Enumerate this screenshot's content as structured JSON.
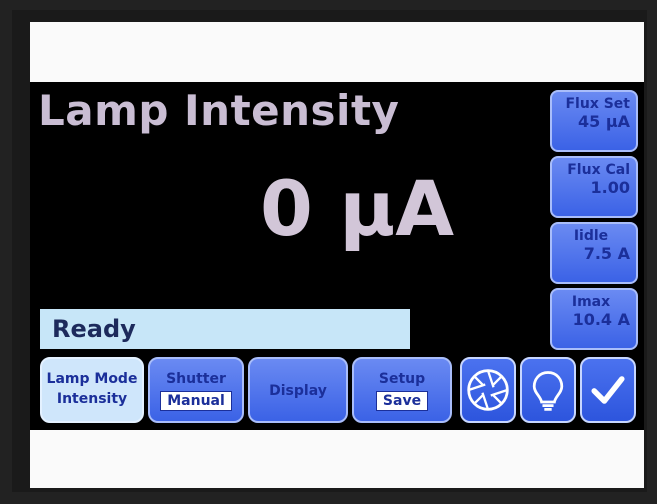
{
  "header": {
    "title": "Lamp Intensity"
  },
  "reading": {
    "value": "0 µA"
  },
  "side_buttons": [
    {
      "label": "Flux Set",
      "value": "45 µA"
    },
    {
      "label": "Flux Cal",
      "value": "1.00"
    },
    {
      "label": "Iidle",
      "value": "7.5 A"
    },
    {
      "label": "Imax",
      "value": "10.4 A"
    }
  ],
  "status": {
    "text": "Ready"
  },
  "bottom_buttons": {
    "lamp_mode": {
      "label": "Lamp Mode",
      "value": "Intensity"
    },
    "shutter": {
      "label": "Shutter",
      "value": "Manual"
    },
    "display": {
      "label": "Display"
    },
    "setup": {
      "label": "Setup",
      "value": "Save"
    }
  },
  "icons": {
    "aperture": "aperture-icon",
    "bulb": "lightbulb-icon",
    "check": "checkmark-icon"
  },
  "colors": {
    "background": "#000000",
    "button_blue": "#3b62e6",
    "status_bar": "#c7e6f8",
    "title_text": "#c9bdd3"
  }
}
